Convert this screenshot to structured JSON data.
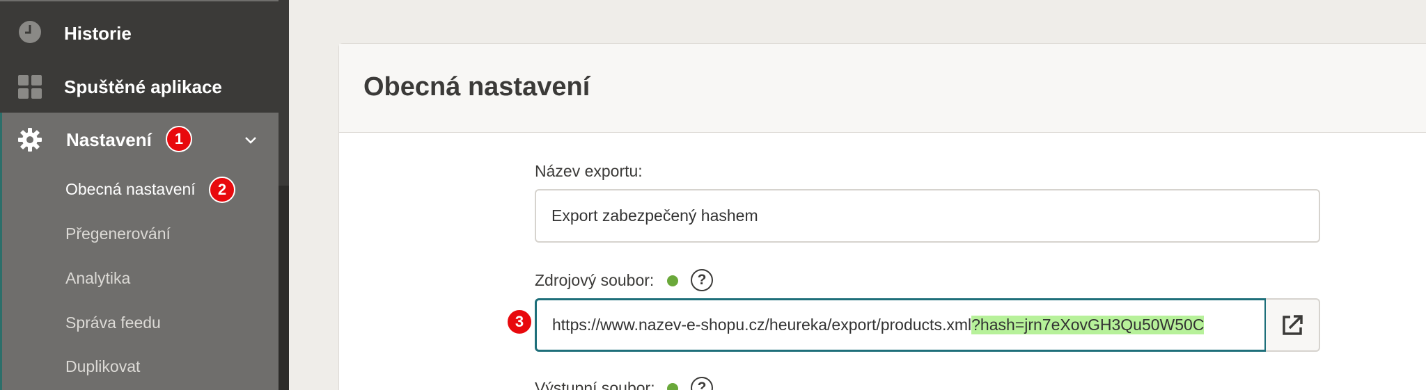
{
  "sidebar": {
    "items": [
      {
        "label": "Historie",
        "icon": "clock-icon"
      },
      {
        "label": "Spuštěné aplikace",
        "icon": "grid-icon"
      },
      {
        "label": "Nastavení",
        "icon": "gear-icon",
        "badge": "1"
      }
    ],
    "subitems": [
      {
        "label": "Obecná nastavení",
        "active": true,
        "badge": "2"
      },
      {
        "label": "Přegenerování"
      },
      {
        "label": "Analytika"
      },
      {
        "label": "Správa feedu"
      },
      {
        "label": "Duplikovat"
      }
    ]
  },
  "main": {
    "title": "Obecná nastavení",
    "fields": {
      "export_name": {
        "label": "Název exportu:",
        "value": "Export zabezpečený hashem"
      },
      "source_file": {
        "label": "Zdrojový soubor:",
        "value_prefix": "https://www.nazev-e-shopu.cz/heureka/export/products.xml",
        "value_hash": "?hash=jrn7eXovGH3Qu50W50C",
        "badge": "3",
        "help": "?"
      },
      "output_file": {
        "label": "Výstupní soubor:",
        "help": "?"
      }
    }
  },
  "colors": {
    "badge": "#e8090d",
    "accent": "#1e6f7a",
    "highlight": "#b7f19a",
    "status_dot": "#6aa83a"
  }
}
